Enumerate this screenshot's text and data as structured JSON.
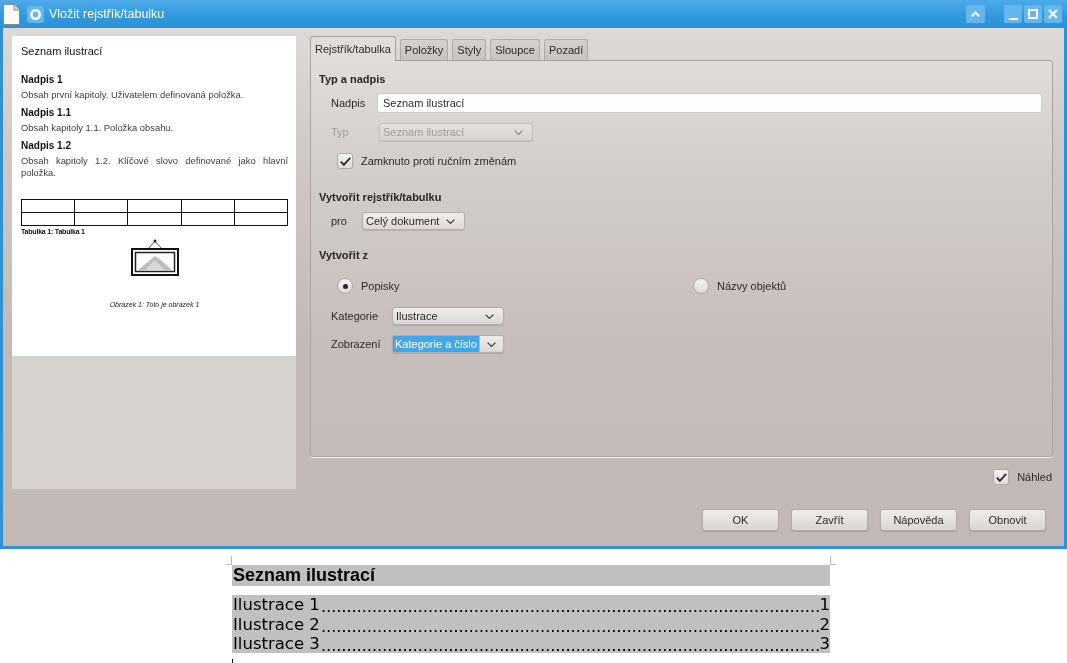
{
  "window": {
    "title": "Vložit rejstřík/tabulku"
  },
  "preview": {
    "title": "Seznam ilustrací",
    "sections": [
      {
        "heading": "Nadpis 1",
        "text": "Obsah první kapitoly. Uživatelem definovaná položka."
      },
      {
        "heading": "Nadpis 1.1",
        "text": "Obsah kapitoly 1.1. Položka obsahu."
      },
      {
        "heading": "Nadpis 1.2",
        "text": "Obsah kapitoly 1.2. Klíčové slovo definované jako hlavní položka."
      }
    ],
    "table_caption": "Tabulka 1: Tabulka 1",
    "image_caption": "Obrázek 1: Toto je obrázek 1"
  },
  "tabs": [
    {
      "label": "Rejstřík/tabulka",
      "selected": true
    },
    {
      "label": "Položky",
      "selected": false
    },
    {
      "label": "Styly",
      "selected": false
    },
    {
      "label": "Sloupce",
      "selected": false
    },
    {
      "label": "Pozadí",
      "selected": false
    }
  ],
  "type_and_title": {
    "heading": "Typ a nadpis",
    "title": {
      "label": "Nadpis",
      "value": "Seznam ilustrací"
    },
    "type": {
      "label": "Typ",
      "value": "Seznam ilustrací",
      "disabled": true
    },
    "protected": {
      "label": "Zamknuto proti ručním změnám",
      "checked": true
    }
  },
  "create_index": {
    "heading": "Vytvořit rejstřík/tabulku",
    "scope": {
      "label": "pro",
      "value": "Celý dokument"
    }
  },
  "create_from": {
    "heading": "Vytvořit z",
    "sources": [
      {
        "label": "Popisky",
        "selected": true
      },
      {
        "label": "Názvy objektů",
        "selected": false
      }
    ],
    "category": {
      "label": "Kategorie",
      "value": "Ilustrace"
    },
    "display": {
      "label": "Zobrazení",
      "value": "Kategorie a číslo",
      "highlighted": true
    }
  },
  "preview_toggle": {
    "label": "Náhled",
    "checked": true
  },
  "buttons": [
    "OK",
    "Zavřít",
    "Nápověda",
    "Obnovit"
  ],
  "document": {
    "heading": "Seznam ilustrací",
    "entries": [
      {
        "title": "Ilustrace 1",
        "page": "1"
      },
      {
        "title": "Ilustrace 2",
        "page": "2"
      },
      {
        "title": "Ilustrace 3",
        "page": "3"
      }
    ]
  }
}
